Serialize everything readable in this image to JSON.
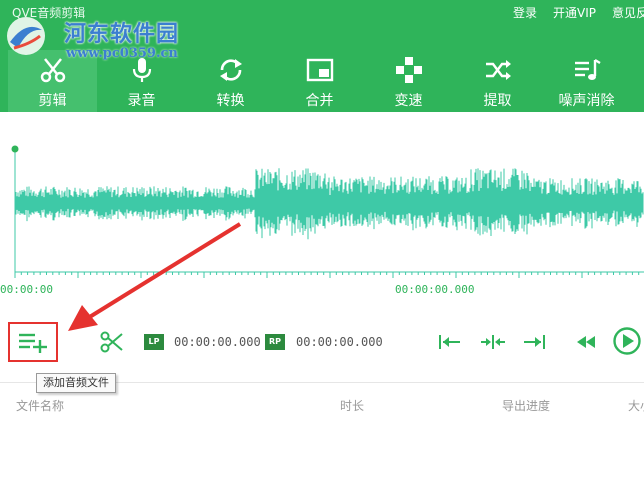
{
  "app": {
    "title": "QVE音频剪辑"
  },
  "topbar": {
    "login": "登录",
    "vip": "开通VIP",
    "user": "意见反"
  },
  "watermark": {
    "name": "河东软件园",
    "url": "www.pc0359.cn"
  },
  "toolbar": {
    "items": [
      {
        "label": "剪辑",
        "icon": "scissors-icon",
        "active": true
      },
      {
        "label": "录音",
        "icon": "microphone-icon"
      },
      {
        "label": "转换",
        "icon": "convert-icon"
      },
      {
        "label": "合并",
        "icon": "merge-icon"
      },
      {
        "label": "变速",
        "icon": "speed-icon"
      },
      {
        "label": "提取",
        "icon": "extract-icon"
      },
      {
        "label": "噪声消除",
        "icon": "noise-icon"
      }
    ]
  },
  "waveform": {
    "start_time": "00:00:00",
    "mid_time": "00:00:00.000",
    "color": "#3ec9a7"
  },
  "controls": {
    "lp_label": "LP",
    "lp_time": "00:00:00.000",
    "rp_label": "RP",
    "rp_time": "00:00:00.000"
  },
  "tooltip": {
    "add_file": "添加音频文件"
  },
  "table": {
    "col_name": "文件名称",
    "col_duration": "时长",
    "col_progress": "导出进度",
    "col_size": "大小"
  },
  "colors": {
    "brand": "#2fb45a",
    "highlight": "#e5322f"
  }
}
